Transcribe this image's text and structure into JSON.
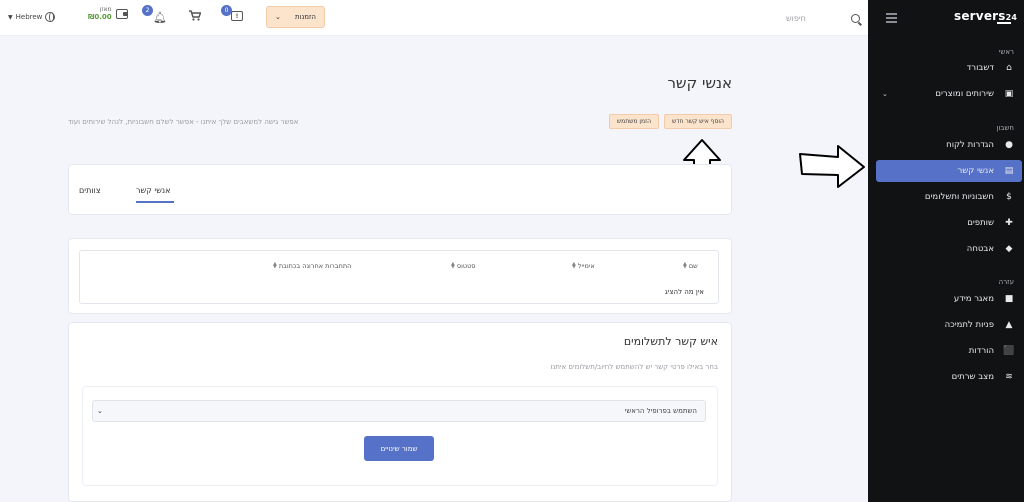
{
  "sidebar": {
    "logo_text": "servers",
    "logo_num": "24",
    "sections": {
      "main": "ראשי",
      "account": "חשבון",
      "help": "עזרה"
    },
    "items": [
      {
        "label": "דשבורד",
        "icon": "home-icon"
      },
      {
        "label": "שירותים ומוצרים",
        "icon": "box-icon"
      },
      {
        "label": "הגדרות לקוח",
        "icon": "user-icon"
      },
      {
        "label": "אנשי קשר",
        "icon": "contact-card-icon"
      },
      {
        "label": "חשבוניות ותשלומים",
        "icon": "dollar-icon"
      },
      {
        "label": "שותפים",
        "icon": "user-plus-icon"
      },
      {
        "label": "אבטחה",
        "icon": "shield-icon"
      },
      {
        "label": "מאגר מידע",
        "icon": "folder-icon"
      },
      {
        "label": "פניות לתמיכה",
        "icon": "support-icon"
      },
      {
        "label": "הורדות",
        "icon": "download-icon"
      },
      {
        "label": "מצב שרתים",
        "icon": "wifi-icon"
      }
    ]
  },
  "topbar": {
    "language": "Hebrew",
    "wallet_label": "מאזן",
    "wallet_amount": "₪0.00",
    "notifications_count": "2",
    "messages_count": "0",
    "orders_label": "הזמנות",
    "search_placeholder": "חיפוש"
  },
  "page": {
    "title": "אנשי קשר",
    "description": "אפשר גישה למשאבים שלך איתנו - אפשר לשלם חשבוניות, לנהל שירותים ועוד",
    "add_contact_button": "הוסף איש קשר חדש",
    "invite_user_button": "הזמן משתמש"
  },
  "tabs": {
    "contacts": "אנשי קשר",
    "invited": "צוותים"
  },
  "table": {
    "headers": {
      "name": "שם",
      "email": "אימייל",
      "status": "סטטוס",
      "last_login": "התחברות אחרונה בכתובת"
    },
    "empty_text": "אין מה להציג"
  },
  "payments": {
    "title": "איש קשר לתשלומים",
    "subtitle": "בחר באילו פרטי קשר יש להשתמש לחיוב/תשלומים איתנו",
    "select_value": "השתמש בפרופיל הראשי",
    "save_button": "שמור שינויים"
  }
}
